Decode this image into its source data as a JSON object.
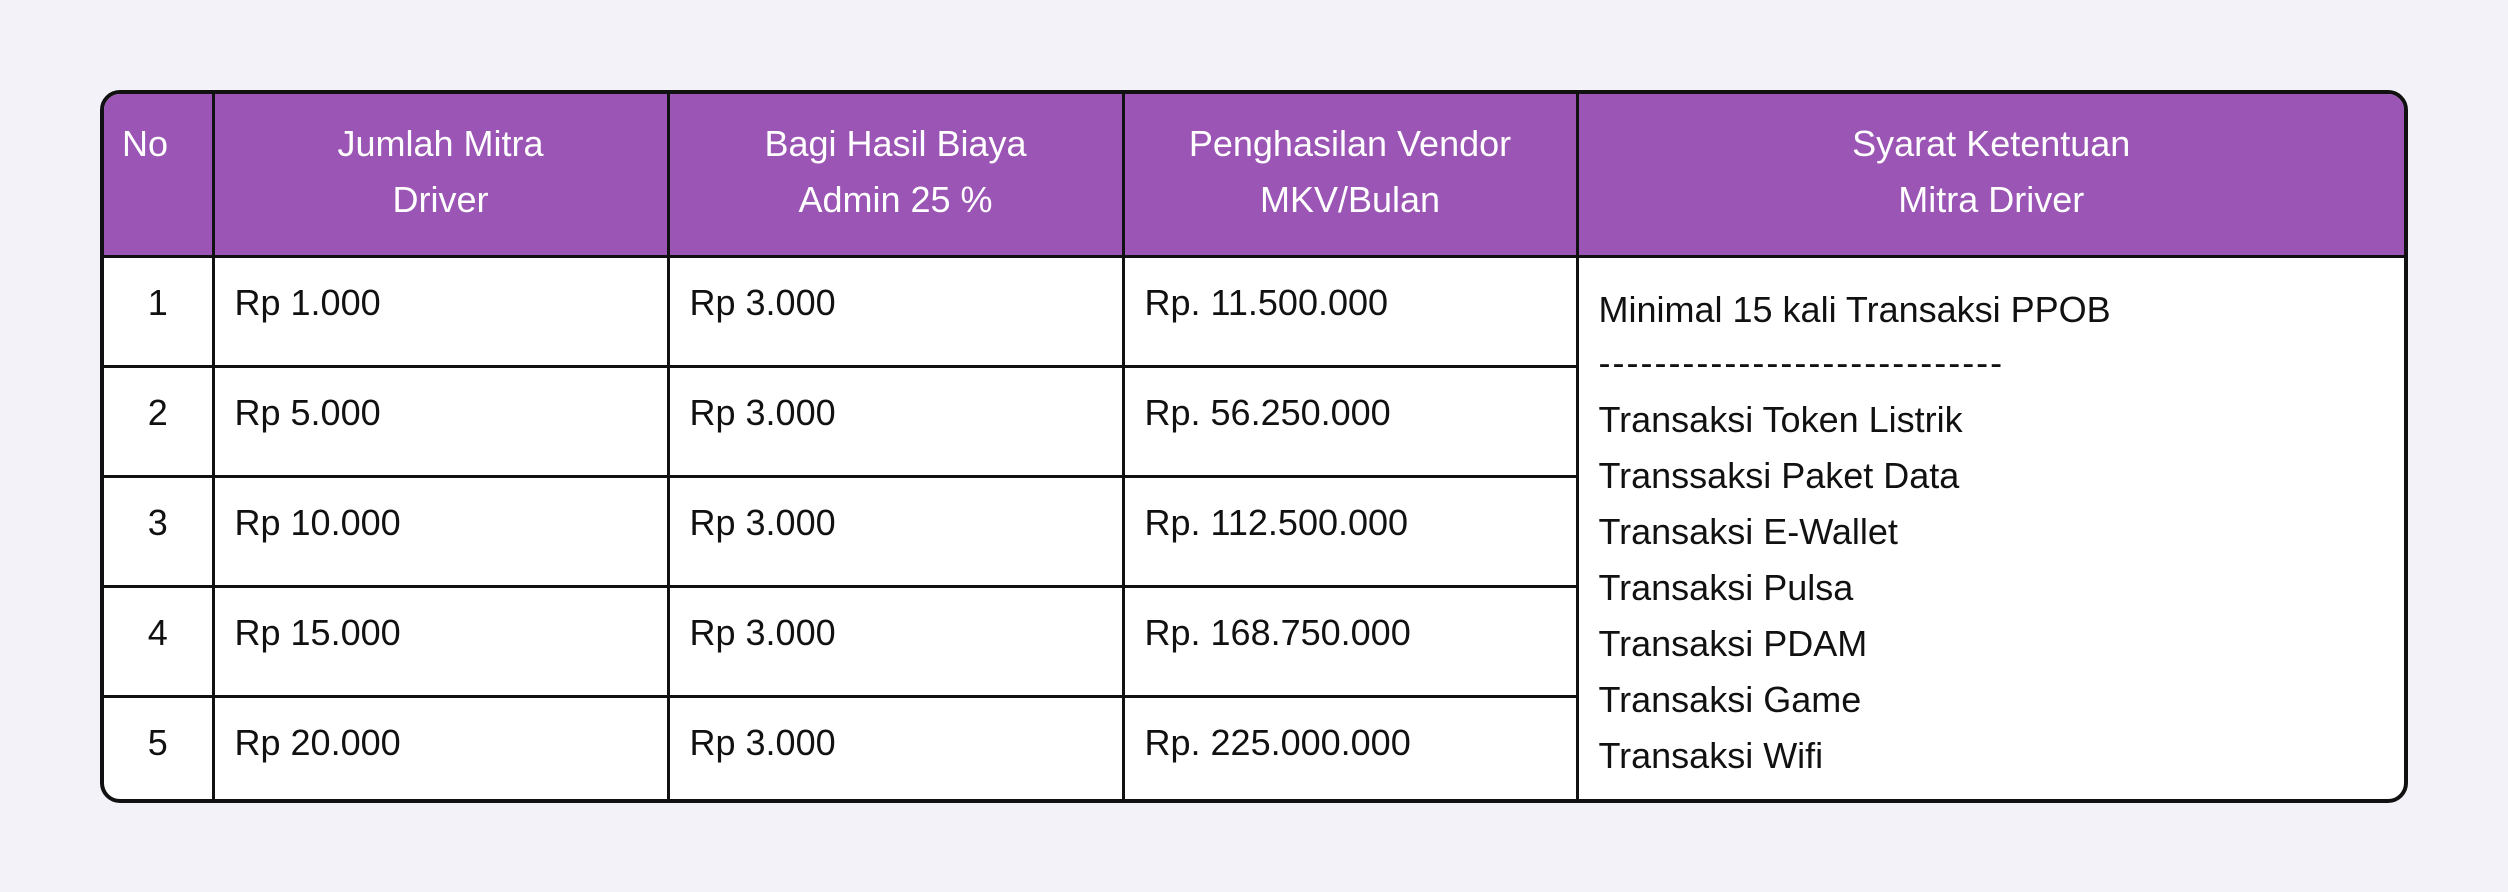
{
  "table": {
    "headers": {
      "no": "No",
      "jumlah_line1": "Jumlah Mitra",
      "jumlah_line2": "Driver",
      "bagi_line1": "Bagi Hasil Biaya",
      "bagi_line2": "Admin 25 %",
      "penghasilan_line1": "Penghasilan Vendor",
      "penghasilan_line2": "MKV/Bulan",
      "syarat_line1": "Syarat Ketentuan",
      "syarat_line2": "Mitra Driver"
    },
    "rows": [
      {
        "no": "1",
        "jumlah": "Rp 1.000",
        "bagi_hasil": "Rp 3.000",
        "penghasilan": "Rp. 11.500.000"
      },
      {
        "no": "2",
        "jumlah": "Rp 5.000",
        "bagi_hasil": "Rp 3.000",
        "penghasilan": "Rp. 56.250.000"
      },
      {
        "no": "3",
        "jumlah": "Rp 10.000",
        "bagi_hasil": "Rp 3.000",
        "penghasilan": "Rp. 112.500.000"
      },
      {
        "no": "4",
        "jumlah": "Rp 15.000",
        "bagi_hasil": "Rp 3.000",
        "penghasilan": "Rp. 168.750.000"
      },
      {
        "no": "5",
        "jumlah": "Rp 20.000",
        "bagi_hasil": "Rp 3.000",
        "penghasilan": "Rp. 225.000.000"
      }
    ],
    "terms": {
      "first": "Minimal 15 kali Transaksi PPOB",
      "divider": "-----------------------------",
      "items": [
        "Transaksi Token Listrik",
        "Transsaksi Paket Data",
        "Transaksi E-Wallet",
        "Transaksi Pulsa",
        "Transaksi PDAM",
        "Transaksi Game",
        "Transaksi Wifi"
      ]
    }
  },
  "colors": {
    "header_bg": "#9b55b5",
    "header_text": "#ffffff",
    "page_bg": "#f4f2f9",
    "border": "#111111"
  }
}
